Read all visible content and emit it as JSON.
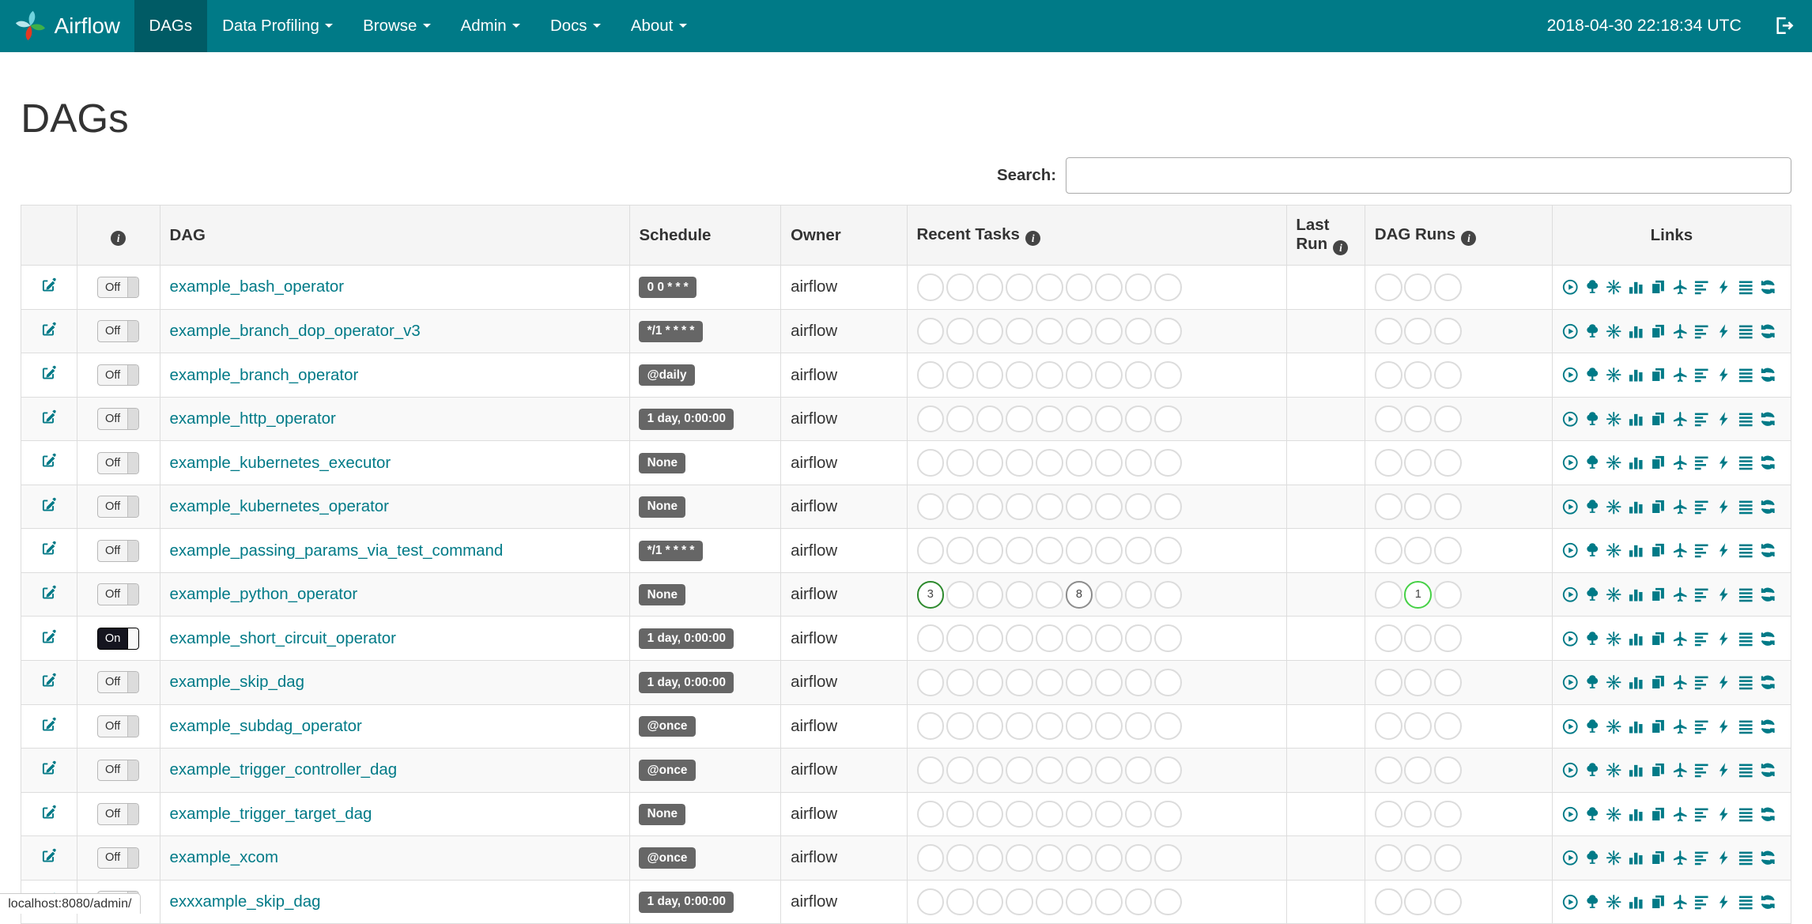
{
  "colors": {
    "accent": "#007A87",
    "navbar_bg": "#007A87",
    "badge_bg": "#666666",
    "success_green": "#2e8b2e",
    "running_lime": "#47d147",
    "neutral_gray": "#8d8d8d"
  },
  "navbar": {
    "brand": "Airflow",
    "items": [
      {
        "label": "DAGs",
        "active": true,
        "dropdown": false
      },
      {
        "label": "Data Profiling",
        "active": false,
        "dropdown": true
      },
      {
        "label": "Browse",
        "active": false,
        "dropdown": true
      },
      {
        "label": "Admin",
        "active": false,
        "dropdown": true
      },
      {
        "label": "Docs",
        "active": false,
        "dropdown": true
      },
      {
        "label": "About",
        "active": false,
        "dropdown": true
      }
    ],
    "clock": "2018-04-30 22:18:34 UTC"
  },
  "page": {
    "title": "DAGs",
    "search_label": "Search:",
    "search_value": ""
  },
  "table": {
    "headers": {
      "dag": "DAG",
      "schedule": "Schedule",
      "owner": "Owner",
      "recent_tasks": "Recent Tasks",
      "last_run": "Last Run",
      "dag_runs": "DAG Runs",
      "links": "Links"
    },
    "recent_task_slots": 9,
    "dag_run_slots": 3,
    "links_icons": [
      "trigger-dag",
      "tree-view",
      "graph-view",
      "task-duration",
      "task-tries",
      "landing-times",
      "gantt",
      "code-view",
      "logs",
      "refresh"
    ],
    "rows": [
      {
        "dag": "example_bash_operator",
        "paused": "Off",
        "schedule": "0 0 * * *",
        "owner": "airflow",
        "recent_tasks": [],
        "dag_runs": []
      },
      {
        "dag": "example_branch_dop_operator_v3",
        "paused": "Off",
        "schedule": "*/1 * * * *",
        "owner": "airflow",
        "recent_tasks": [],
        "dag_runs": []
      },
      {
        "dag": "example_branch_operator",
        "paused": "Off",
        "schedule": "@daily",
        "owner": "airflow",
        "recent_tasks": [],
        "dag_runs": []
      },
      {
        "dag": "example_http_operator",
        "paused": "Off",
        "schedule": "1 day, 0:00:00",
        "owner": "airflow",
        "recent_tasks": [],
        "dag_runs": []
      },
      {
        "dag": "example_kubernetes_executor",
        "paused": "Off",
        "schedule": "None",
        "owner": "airflow",
        "recent_tasks": [],
        "dag_runs": []
      },
      {
        "dag": "example_kubernetes_operator",
        "paused": "Off",
        "schedule": "None",
        "owner": "airflow",
        "recent_tasks": [],
        "dag_runs": []
      },
      {
        "dag": "example_passing_params_via_test_command",
        "paused": "Off",
        "schedule": "*/1 * * * *",
        "owner": "airflow",
        "recent_tasks": [],
        "dag_runs": []
      },
      {
        "dag": "example_python_operator",
        "paused": "Off",
        "schedule": "None",
        "owner": "airflow",
        "recent_tasks": [
          {
            "slot": 0,
            "count": "3",
            "color": "#2e8b2e"
          },
          {
            "slot": 5,
            "count": "8",
            "color": "#8d8d8d"
          }
        ],
        "dag_runs": [
          {
            "slot": 1,
            "count": "1",
            "color": "#47d147"
          }
        ]
      },
      {
        "dag": "example_short_circuit_operator",
        "paused": "On",
        "schedule": "1 day, 0:00:00",
        "owner": "airflow",
        "recent_tasks": [],
        "dag_runs": []
      },
      {
        "dag": "example_skip_dag",
        "paused": "Off",
        "schedule": "1 day, 0:00:00",
        "owner": "airflow",
        "recent_tasks": [],
        "dag_runs": []
      },
      {
        "dag": "example_subdag_operator",
        "paused": "Off",
        "schedule": "@once",
        "owner": "airflow",
        "recent_tasks": [],
        "dag_runs": []
      },
      {
        "dag": "example_trigger_controller_dag",
        "paused": "Off",
        "schedule": "@once",
        "owner": "airflow",
        "recent_tasks": [],
        "dag_runs": []
      },
      {
        "dag": "example_trigger_target_dag",
        "paused": "Off",
        "schedule": "None",
        "owner": "airflow",
        "recent_tasks": [],
        "dag_runs": []
      },
      {
        "dag": "example_xcom",
        "paused": "Off",
        "schedule": "@once",
        "owner": "airflow",
        "recent_tasks": [],
        "dag_runs": []
      },
      {
        "dag": "exxxample_skip_dag",
        "paused": "Off",
        "schedule": "1 day, 0:00:00",
        "owner": "airflow",
        "recent_tasks": [],
        "dag_runs": []
      }
    ]
  },
  "status_bar": "localhost:8080/admin/"
}
